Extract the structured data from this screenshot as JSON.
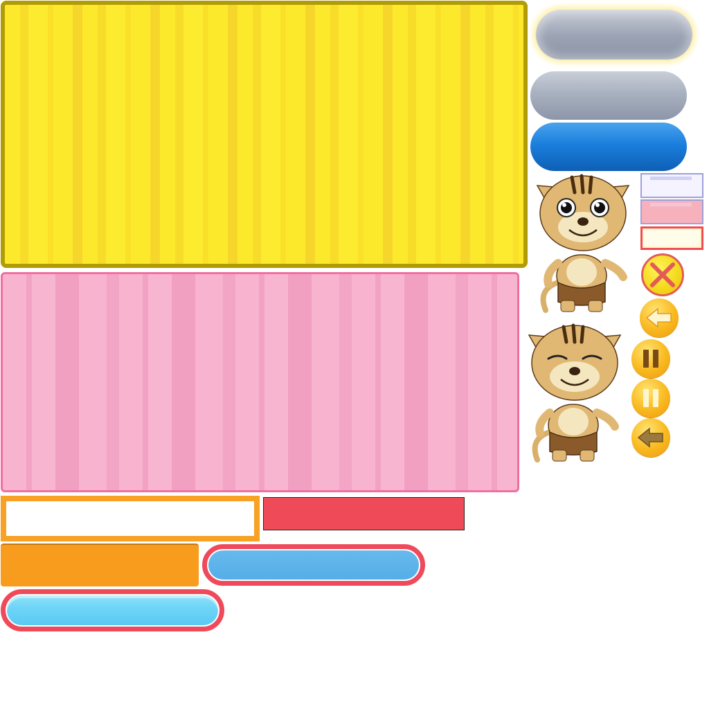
{
  "sprites": {
    "colors": {
      "yellow_panel": "#fde92b",
      "yellow_border": "#b39b06",
      "pink_panel": "#f8b3cf",
      "pink_border": "#f06fa0",
      "orange": "#f89c1e",
      "red": "#ef4a57",
      "blue": "#1a7fdc",
      "cyan": "#6fd5f7"
    },
    "icons": [
      "close-icon",
      "back-arrow-icon",
      "pause-icon",
      "pause-icon",
      "back-arrow-icon"
    ],
    "characters": [
      "tiger-cub-open-eyes",
      "tiger-cub-closed-eyes"
    ]
  }
}
